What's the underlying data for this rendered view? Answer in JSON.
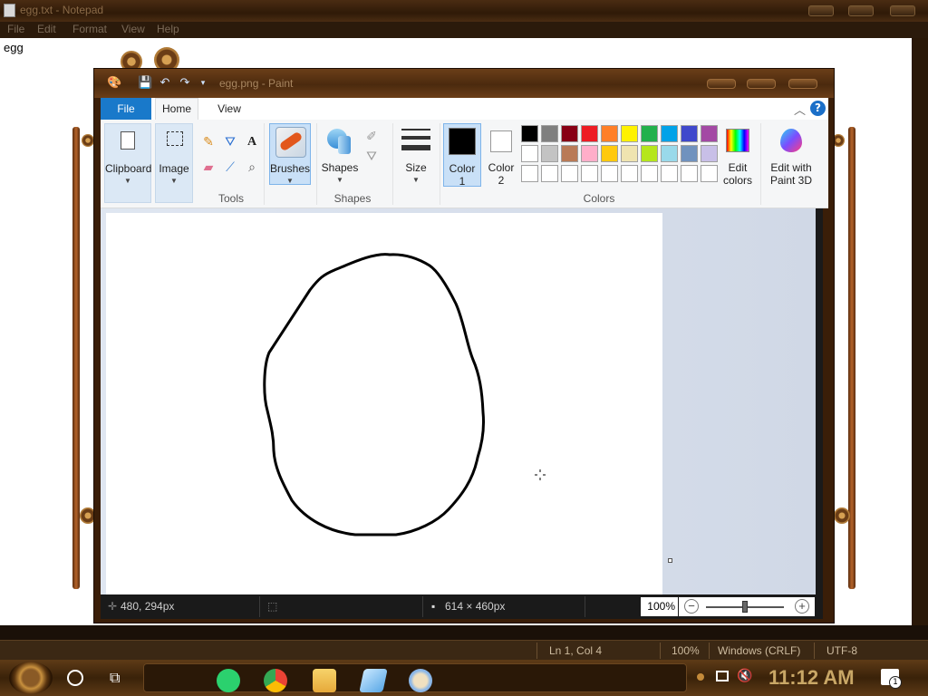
{
  "notepad": {
    "title": "egg.txt - Notepad",
    "menu": [
      "File",
      "Edit",
      "Format",
      "View",
      "Help"
    ],
    "content": "egg",
    "status": {
      "position": "Ln 1, Col 4",
      "zoom": "100%",
      "line_ending": "Windows (CRLF)",
      "encoding": "UTF-8"
    }
  },
  "paint": {
    "title": "egg.png - Paint",
    "tabs": {
      "file": "File",
      "home": "Home",
      "view": "View"
    },
    "help": "?",
    "ribbon": {
      "clipboard": "Clipboard",
      "image": "Image",
      "brushes": "Brushes",
      "shapes": "Shapes",
      "size": "Size",
      "color1_line1": "Color",
      "color1_line2": "1",
      "color2_line1": "Color",
      "color2_line2": "2",
      "edit_colors_line1": "Edit",
      "edit_colors_line2": "colors",
      "paint3d_line1": "Edit with",
      "paint3d_line2": "Paint 3D",
      "groups": {
        "tools": "Tools",
        "shapes": "Shapes",
        "colors": "Colors"
      }
    },
    "palette_row1": [
      "#000000",
      "#7f7f7f",
      "#880015",
      "#ed1c24",
      "#ff7f27",
      "#fff200",
      "#22b14c",
      "#00a2e8",
      "#3f48cc",
      "#a349a4"
    ],
    "palette_row2": [
      "#ffffff",
      "#c3c3c3",
      "#b97a57",
      "#ffaec9",
      "#ffc90e",
      "#efe4b0",
      "#b5e61d",
      "#99d9ea",
      "#7092be",
      "#c8bfe7"
    ],
    "status": {
      "cursor": "480, 294px",
      "canvas_size": "614 × 460px",
      "zoom": "100%"
    }
  },
  "taskbar": {
    "clock": "11:12 AM",
    "notifications": "1"
  }
}
